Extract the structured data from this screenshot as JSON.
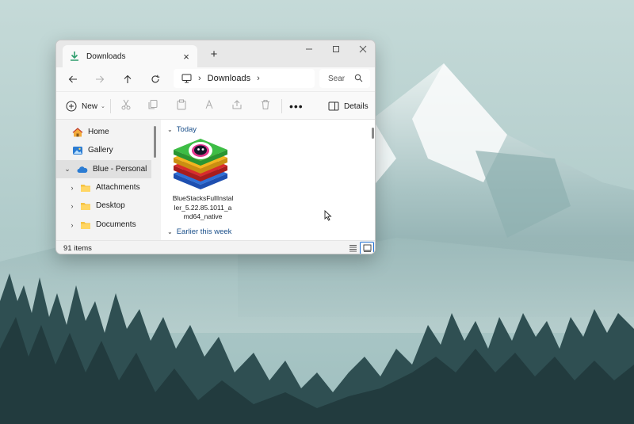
{
  "window": {
    "tab_title": "Downloads",
    "address": {
      "location": "Downloads"
    },
    "search": {
      "placeholder": "Sear"
    }
  },
  "commandbar": {
    "new_label": "New",
    "details_label": "Details"
  },
  "sidebar": {
    "items": [
      {
        "label": "Home",
        "icon": "home-icon"
      },
      {
        "label": "Gallery",
        "icon": "gallery-icon"
      },
      {
        "label": "Blue - Personal",
        "icon": "onedrive-cloud-icon"
      },
      {
        "label": "Attachments",
        "icon": "folder-icon"
      },
      {
        "label": "Desktop",
        "icon": "folder-icon"
      },
      {
        "label": "Documents",
        "icon": "folder-icon"
      }
    ]
  },
  "content": {
    "groups": [
      {
        "label": "Today"
      },
      {
        "label": "Earlier this week"
      }
    ],
    "file": {
      "name": "BlueStacksFullInstaller_5.22.85.1011_amd64_native",
      "icon": "bluestacks-app-icon"
    }
  },
  "status": {
    "items_count": "91 items"
  },
  "colors": {
    "accent": "#1f6fd1",
    "folder": "#f4c242",
    "cloud": "#2b7cd3"
  }
}
